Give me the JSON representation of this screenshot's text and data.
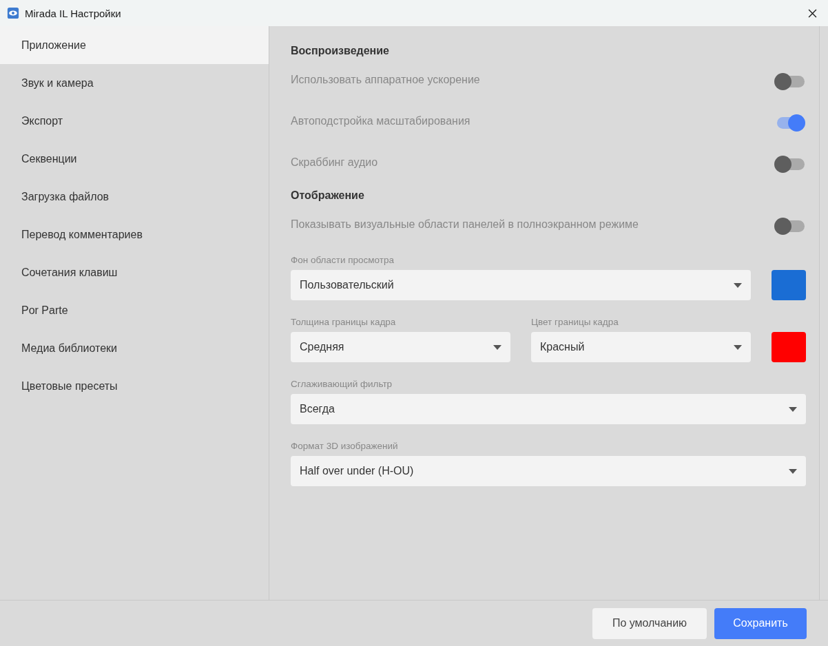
{
  "window": {
    "title": "Mirada IL Настройки"
  },
  "sidebar": {
    "items": [
      {
        "label": "Приложение",
        "selected": true
      },
      {
        "label": "Звук и камера",
        "selected": false
      },
      {
        "label": "Экспорт",
        "selected": false
      },
      {
        "label": "Секвенции",
        "selected": false
      },
      {
        "label": "Загрузка файлов",
        "selected": false
      },
      {
        "label": "Перевод комментариев",
        "selected": false
      },
      {
        "label": "Сочетания клавиш",
        "selected": false
      },
      {
        "label": "Por Parte",
        "selected": false
      },
      {
        "label": "Медиа библиотеки",
        "selected": false
      },
      {
        "label": "Цветовые пресеты",
        "selected": false
      }
    ]
  },
  "sections": [
    {
      "heading": "Воспроизведение",
      "items": [
        {
          "kind": "toggle",
          "label": "Использовать аппаратное ускорение",
          "on": false
        },
        {
          "kind": "toggle",
          "label": "Автоподстройка масштабирования",
          "on": true
        },
        {
          "kind": "toggle",
          "label": "Скраббинг аудио",
          "on": false
        }
      ]
    },
    {
      "heading": "Отображение",
      "items": [
        {
          "kind": "toggle",
          "label": "Показывать визуальные области панелей в полноэкранном режиме",
          "on": false
        },
        {
          "kind": "selects",
          "fields": [
            {
              "label": "Фон области просмотра",
              "value": "Пользовательский"
            }
          ],
          "color": "#1a6dd4"
        },
        {
          "kind": "selects",
          "fields": [
            {
              "label": "Толщина границы кадра",
              "value": "Средняя"
            },
            {
              "label": "Цвет границы кадра",
              "value": "Красный"
            }
          ],
          "color": "#ff0000"
        },
        {
          "kind": "selects",
          "fields": [
            {
              "label": "Сглаживающий фильтр",
              "value": "Всегда"
            }
          ]
        },
        {
          "kind": "selects",
          "fields": [
            {
              "label": "Формат 3D изображений",
              "value": "Half over under (H-OU)"
            }
          ]
        }
      ]
    }
  ],
  "buttons": [
    {
      "label": "По умолчанию",
      "kind": "secondary"
    },
    {
      "label": "Сохранить",
      "kind": "primary"
    }
  ]
}
